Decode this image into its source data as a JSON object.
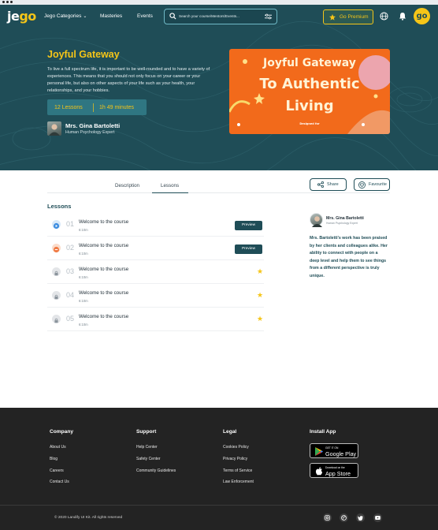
{
  "nav": {
    "logo_text": "jego",
    "categories": "Jego Categories",
    "masteries": "Masteries",
    "events": "Events",
    "search_placeholder": "Search your course/Mentors/Events...",
    "premium": "Go Premium",
    "avatar_text": "go"
  },
  "course": {
    "title": "Joyful Gateway",
    "description": "To live a full spectrum life, it is important to be well-rounded and to have a variety of experiences. This means that you should not only focus on your career or your personal life, but also on other aspects of your life such as your health, your relationships, and your hobbies.",
    "lessons_count": "12 Lessons",
    "duration": "1h 49 minutes",
    "author_name": "Mrs. Gina Bartoletti",
    "author_role": "Human Psychology Expert",
    "banner_lines": [
      "Joyful Gateway",
      "To Authentic",
      "Living"
    ],
    "banner_caption": "Designed for"
  },
  "tabs": [
    "Description",
    "Lessons"
  ],
  "active_tab": "Lessons",
  "actions": {
    "share": "Share",
    "favourite": "Favourite"
  },
  "lessons_heading": "Lessons",
  "lessons": [
    {
      "num": "01",
      "title": "Welcome to the course",
      "duration": "6:10m",
      "state": "play",
      "action": "Preview"
    },
    {
      "num": "02",
      "title": "Welcome to the course",
      "duration": "6:10m",
      "state": "pause",
      "action": "Preview"
    },
    {
      "num": "03",
      "title": "Welcome to the course",
      "duration": "6:10m",
      "state": "locked",
      "action": ""
    },
    {
      "num": "04",
      "title": "Welcome to the course",
      "duration": "6:10m",
      "state": "locked",
      "action": ""
    },
    {
      "num": "05",
      "title": "Welcome to the course",
      "duration": "6:10m",
      "state": "locked",
      "action": ""
    }
  ],
  "sidebar": {
    "author_name": "Mrs. Gina Bartoletti",
    "author_role": "Human Psychology Expert",
    "bio": "Mrs. Bartoletti's work has been praised by her clients and colleagues alike. Her ability to connect with people on a deep level and help them to see things from a different perspective is truly unique."
  },
  "footer": {
    "company": {
      "heading": "Company",
      "links": [
        "About Us",
        "Blog",
        "Careers",
        "Contact Us"
      ]
    },
    "support": {
      "heading": "Support",
      "links": [
        "Help Center",
        "Safety Center",
        "Community Guidelines"
      ]
    },
    "legal": {
      "heading": "Legal",
      "links": [
        "Cookies Policy",
        "Privacy Policy",
        "Terms of Service",
        "Law Enforcement"
      ]
    },
    "install": {
      "heading": "Install App",
      "google_small": "GET IT ON",
      "google_big": "Google Play",
      "apple_small": "Download on the",
      "apple_big": "App Store"
    },
    "copyright": "© 2020 Landify UI Kit. All rights reserved",
    "social_icons": [
      "instagram-icon",
      "dribbble-icon",
      "twitter-icon",
      "youtube-icon"
    ]
  },
  "colors": {
    "teal": "#1f4d57",
    "accent": "#f5c518",
    "banner": "#f26a1b",
    "footer": "#232323"
  }
}
